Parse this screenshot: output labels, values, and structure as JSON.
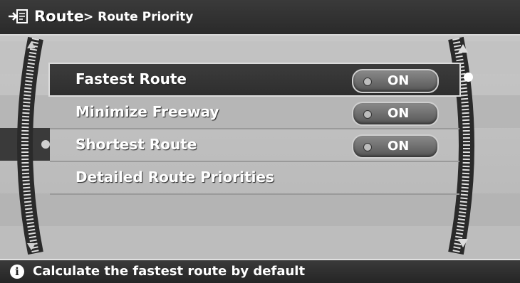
{
  "header": {
    "title": "Route",
    "breadcrumb": "> Route Priority",
    "icon": "route-menu-icon"
  },
  "menu": {
    "items": [
      {
        "label": "Fastest Route",
        "toggle": "ON",
        "selected": true
      },
      {
        "label": "Minimize Freeway",
        "toggle": "ON",
        "selected": false
      },
      {
        "label": "Shortest Route",
        "toggle": "ON",
        "selected": false
      },
      {
        "label": "Detailed Route Priorities",
        "toggle": null,
        "selected": false
      }
    ]
  },
  "footer": {
    "info_icon": "info-icon",
    "message": "Calculate the fastest route by default"
  }
}
